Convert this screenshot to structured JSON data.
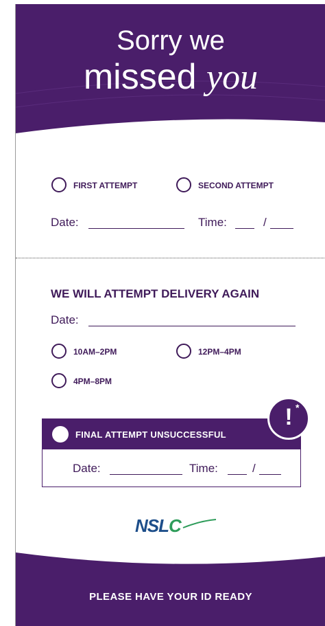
{
  "header": {
    "title_line1": "Sorry we",
    "title_line2_word": "missed",
    "title_line2_emphasis": "you"
  },
  "first_section": {
    "options": [
      {
        "label": "FIRST ATTEMPT"
      },
      {
        "label": "SECOND ATTEMPT"
      }
    ],
    "date_label": "Date:",
    "time_label": "Time:",
    "time_separator": "/"
  },
  "second_section": {
    "heading": "WE WILL ATTEMPT DELIVERY AGAIN",
    "date_label": "Date:",
    "slots": [
      {
        "label": "10AM–2PM"
      },
      {
        "label": "12PM–4PM"
      },
      {
        "label": "4PM–8PM"
      }
    ]
  },
  "final": {
    "label": "FINAL ATTEMPT UNSUCCESSFUL",
    "alert_mark": "!",
    "alert_star": "*",
    "date_label": "Date:",
    "time_label": "Time:",
    "time_separator": "/"
  },
  "logo": {
    "text_main": "NSL",
    "text_accent": "C"
  },
  "footer": {
    "text": "PLEASE HAVE YOUR ID READY"
  },
  "colors": {
    "purple": "#4a1e6a",
    "text_purple": "#3f1a59",
    "logo_blue": "#1d4e8a",
    "logo_green": "#2e9c5a"
  }
}
